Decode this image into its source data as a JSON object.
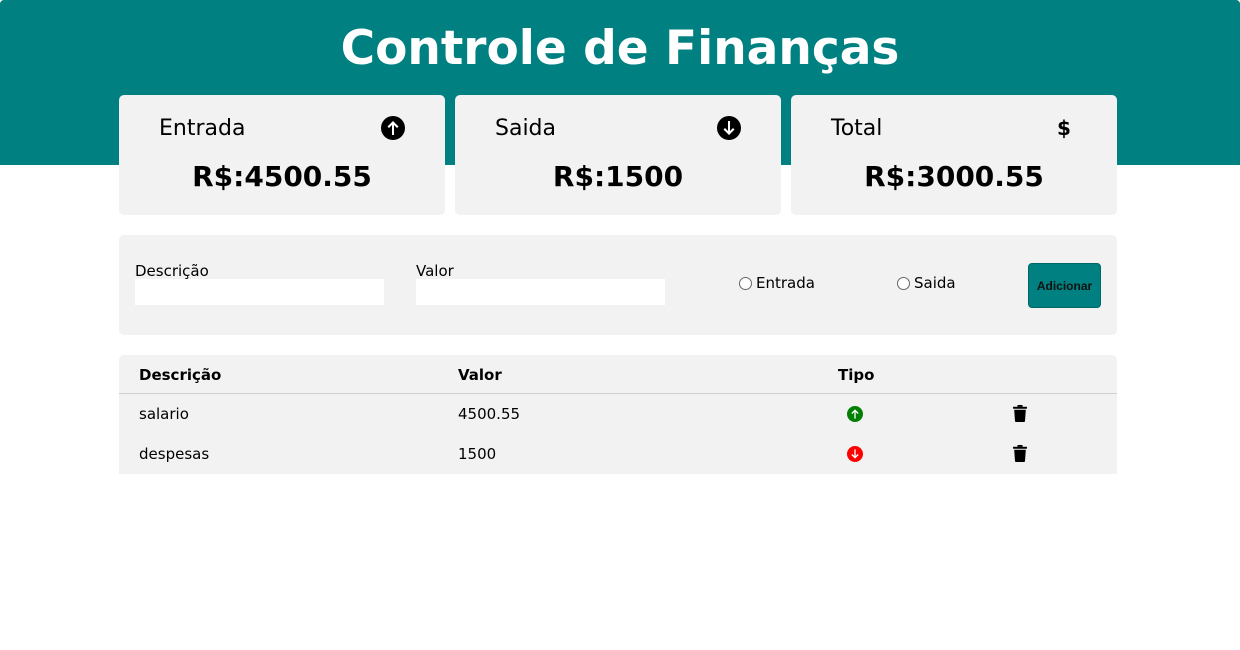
{
  "header": {
    "title": "Controle de Finanças",
    "background": "#008080"
  },
  "cards": [
    {
      "label": "Entrada",
      "value": "R$:4500.55",
      "icon": "arrow-up-circle-icon"
    },
    {
      "label": "Saida",
      "value": "R$:1500",
      "icon": "arrow-down-circle-icon"
    },
    {
      "label": "Total",
      "value": "R$:3000.55",
      "icon": "dollar-icon",
      "icon_glyph": "$"
    }
  ],
  "form": {
    "descricao_label": "Descrição",
    "descricao_value": "",
    "valor_label": "Valor",
    "valor_value": "",
    "radio_entrada_label": "Entrada",
    "radio_saida_label": "Saida",
    "add_button_label": "Adicionar"
  },
  "table": {
    "columns": [
      "Descrição",
      "Valor",
      "Tipo"
    ],
    "rows": [
      {
        "descricao": "salario",
        "valor": "4500.55",
        "tipo": "entrada",
        "tipo_color": "#008000",
        "icon": "arrow-up-circle-icon"
      },
      {
        "descricao": "despesas",
        "valor": "1500",
        "tipo": "saida",
        "tipo_color": "#ff0000",
        "icon": "arrow-down-circle-icon"
      }
    ]
  },
  "colors": {
    "accent": "#008080",
    "panel": "#f2f2f2",
    "entrada": "#008000",
    "saida": "#ff0000"
  }
}
